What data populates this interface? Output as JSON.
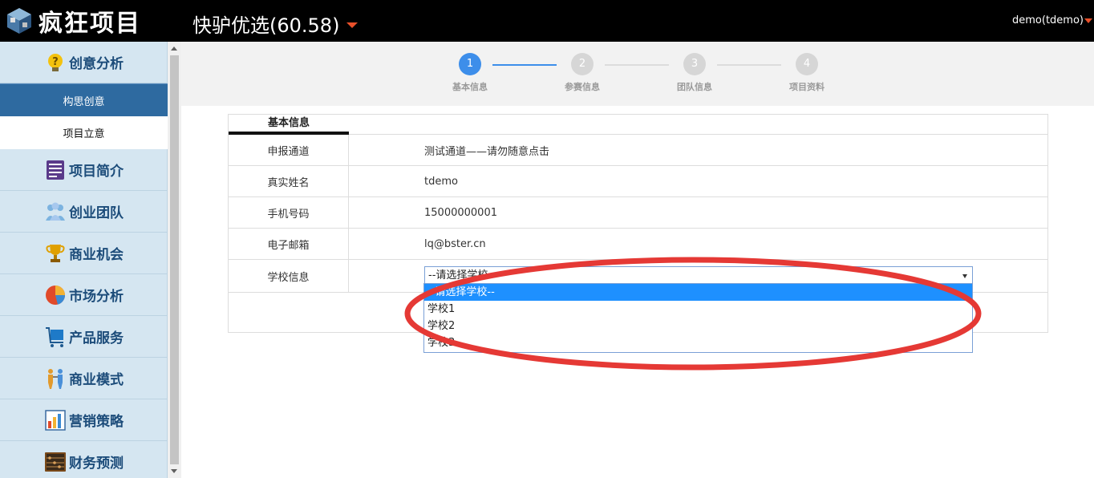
{
  "header": {
    "logo_text": "疯狂项目",
    "project_title": "快驴优选(60.58)",
    "user": "demo(tdemo)"
  },
  "sidebar": {
    "sections": [
      {
        "label": "创意分析",
        "icon": "lightbulb-icon"
      },
      {
        "label": "项目简介",
        "icon": "document-icon"
      },
      {
        "label": "创业团队",
        "icon": "team-icon"
      },
      {
        "label": "商业机会",
        "icon": "trophy-icon"
      },
      {
        "label": "市场分析",
        "icon": "pie-chart-icon"
      },
      {
        "label": "产品服务",
        "icon": "cart-icon"
      },
      {
        "label": "商业模式",
        "icon": "people-icon"
      },
      {
        "label": "营销策略",
        "icon": "bar-chart-icon"
      },
      {
        "label": "财务预测",
        "icon": "abacus-icon"
      }
    ],
    "subitems": [
      {
        "label": "构思创意",
        "active": true
      },
      {
        "label": "项目立意",
        "active": false
      }
    ]
  },
  "stepper": [
    {
      "num": "1",
      "label": "基本信息",
      "active": true
    },
    {
      "num": "2",
      "label": "参赛信息",
      "active": false
    },
    {
      "num": "3",
      "label": "团队信息",
      "active": false
    },
    {
      "num": "4",
      "label": "项目资料",
      "active": false
    }
  ],
  "form": {
    "tab_label": "基本信息",
    "rows": [
      {
        "label": "申报通道",
        "value": "测试通道——请勿随意点击"
      },
      {
        "label": "真实姓名",
        "value": "tdemo"
      },
      {
        "label": "手机号码",
        "value": "15000000001"
      },
      {
        "label": "电子邮箱",
        "value": "lq@bster.cn"
      }
    ],
    "school": {
      "label": "学校信息",
      "selected": "--请选择学校--",
      "options": [
        "--请选择学校--",
        "学校1",
        "学校2",
        "学校3"
      ]
    }
  },
  "colors": {
    "accent": "#3d8eea",
    "sidebar_bg": "#d5e6f1",
    "sidebar_active": "#2e6aa0",
    "annotation": "#e53935",
    "header_bg": "#000000"
  }
}
